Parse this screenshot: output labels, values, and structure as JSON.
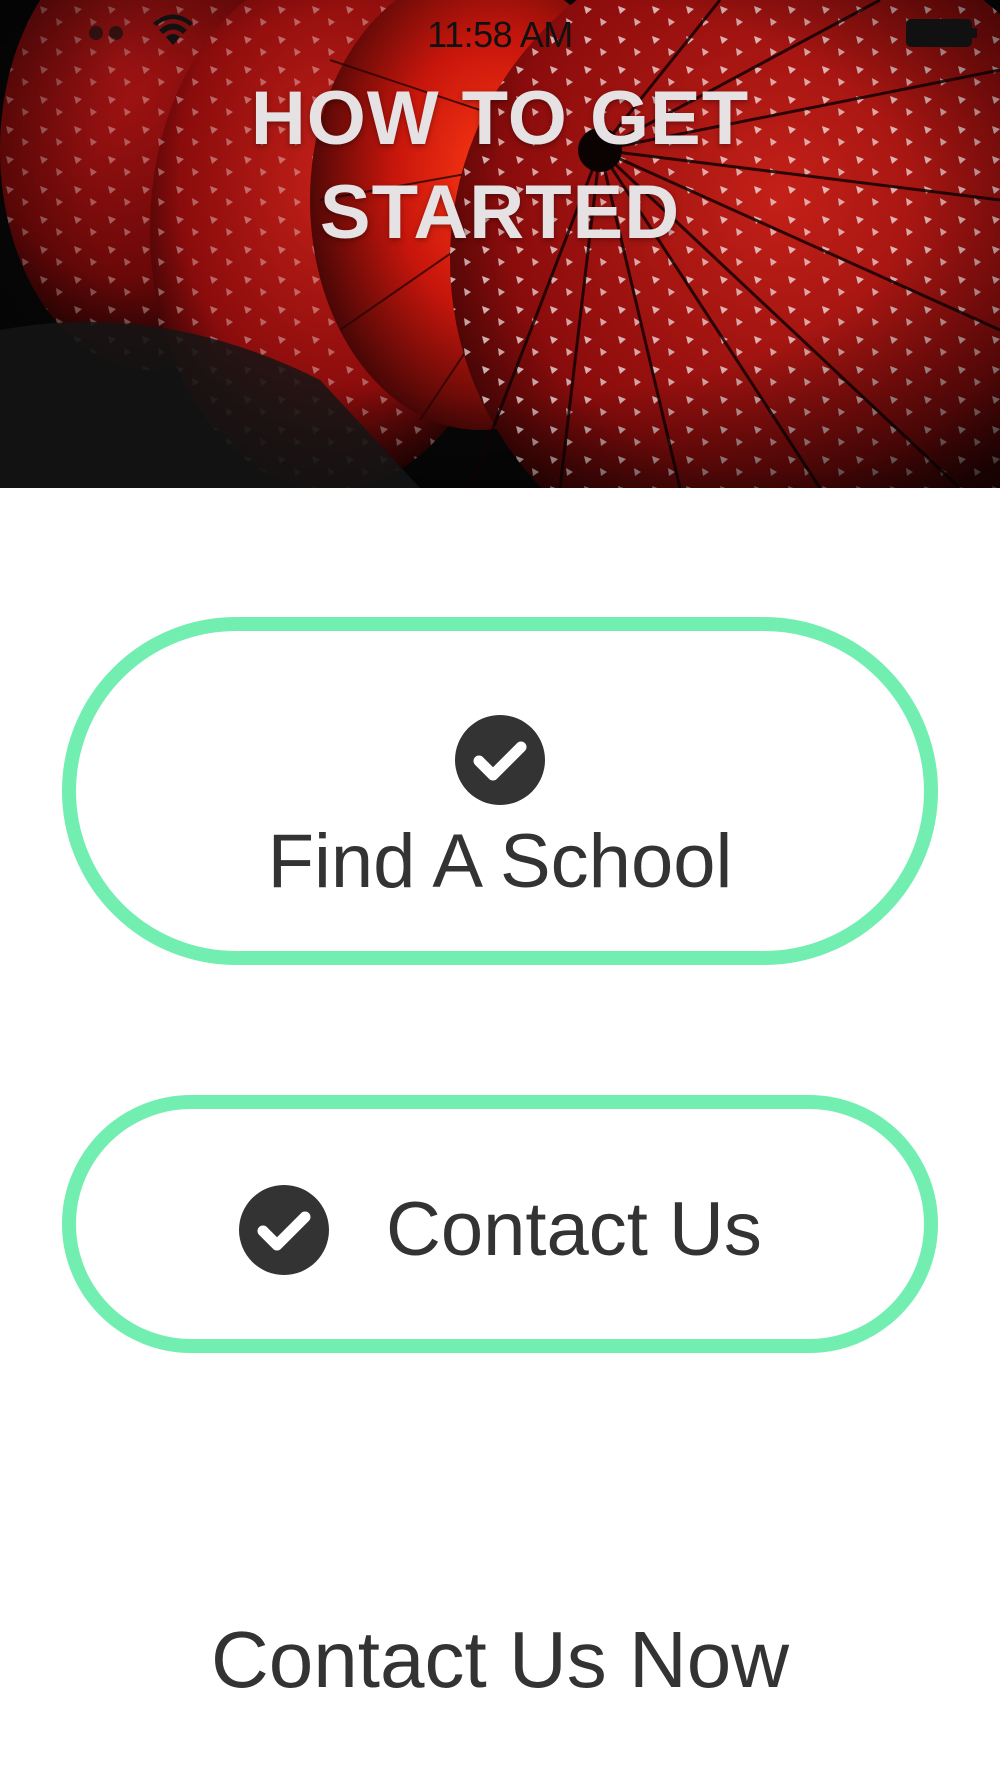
{
  "status_bar": {
    "time": "11:58 AM"
  },
  "hero": {
    "title_line1": "HOW TO GET",
    "title_line2": "STARTED"
  },
  "buttons": {
    "find_school_label": "Find A School",
    "contact_us_label": "Contact Us"
  },
  "footer_link": {
    "label": "Contact Us Now"
  },
  "colors": {
    "accent": "#72eeb0",
    "text": "#333333",
    "hero_title": "#e6e2e4"
  },
  "icons": {
    "status": [
      "wifi-icon",
      "battery-icon"
    ],
    "buttons": "checkmark-circle-icon"
  }
}
